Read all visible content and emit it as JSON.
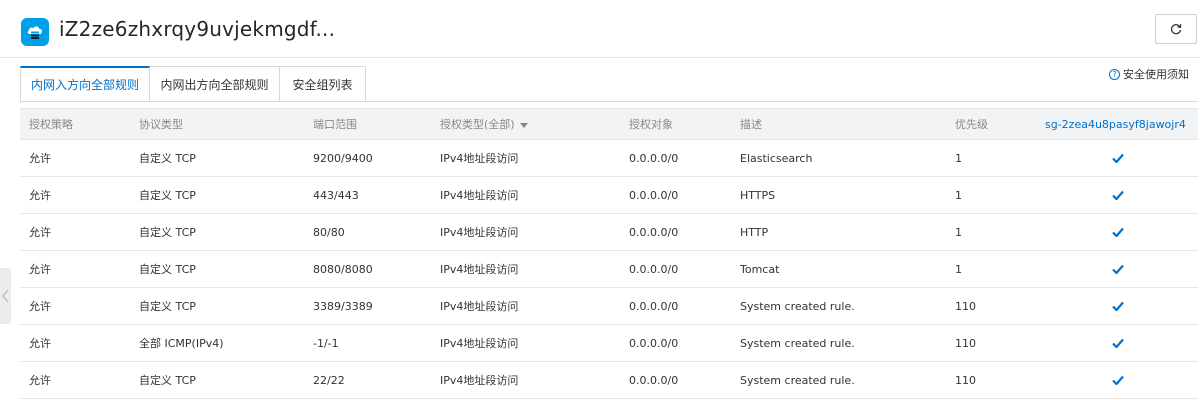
{
  "header": {
    "title": "iZ2ze6zhxrqy9uvjekmgdf...",
    "app_icon": "cloud-server-icon",
    "refresh_icon": "refresh-icon"
  },
  "tabs": [
    {
      "label": "内网入方向全部规则",
      "active": true
    },
    {
      "label": "内网出方向全部规则",
      "active": false
    },
    {
      "label": "安全组列表",
      "active": false
    }
  ],
  "notice": {
    "icon": "question-circle-icon",
    "label": "安全使用须知"
  },
  "table": {
    "columns": {
      "policy": "授权策略",
      "protocol": "协议类型",
      "ports": "端口范围",
      "auth_type": "授权类型(全部)",
      "target": "授权对象",
      "desc": "描述",
      "priority": "优先级",
      "group": "sg-2zea4u8pasyf8jawojr4"
    },
    "rows": [
      {
        "policy": "允许",
        "protocol": "自定义 TCP",
        "ports": "9200/9400",
        "auth_type": "IPv4地址段访问",
        "target": "0.0.0.0/0",
        "desc": "Elasticsearch",
        "priority": "1",
        "checked": true
      },
      {
        "policy": "允许",
        "protocol": "自定义 TCP",
        "ports": "443/443",
        "auth_type": "IPv4地址段访问",
        "target": "0.0.0.0/0",
        "desc": "HTTPS",
        "priority": "1",
        "checked": true
      },
      {
        "policy": "允许",
        "protocol": "自定义 TCP",
        "ports": "80/80",
        "auth_type": "IPv4地址段访问",
        "target": "0.0.0.0/0",
        "desc": "HTTP",
        "priority": "1",
        "checked": true
      },
      {
        "policy": "允许",
        "protocol": "自定义 TCP",
        "ports": "8080/8080",
        "auth_type": "IPv4地址段访问",
        "target": "0.0.0.0/0",
        "desc": "Tomcat",
        "priority": "1",
        "checked": true
      },
      {
        "policy": "允许",
        "protocol": "自定义 TCP",
        "ports": "3389/3389",
        "auth_type": "IPv4地址段访问",
        "target": "0.0.0.0/0",
        "desc": "System created rule.",
        "priority": "110",
        "checked": true
      },
      {
        "policy": "允许",
        "protocol": "全部 ICMP(IPv4)",
        "ports": "-1/-1",
        "auth_type": "IPv4地址段访问",
        "target": "0.0.0.0/0",
        "desc": "System created rule.",
        "priority": "110",
        "checked": true
      },
      {
        "policy": "允许",
        "protocol": "自定义 TCP",
        "ports": "22/22",
        "auth_type": "IPv4地址段访问",
        "target": "0.0.0.0/0",
        "desc": "System created rule.",
        "priority": "110",
        "checked": true
      }
    ]
  },
  "colors": {
    "accent": "#0070cc",
    "icon_bg": "#00a0e9",
    "header_bg": "#f2f3f5",
    "check": "#0070cc"
  }
}
